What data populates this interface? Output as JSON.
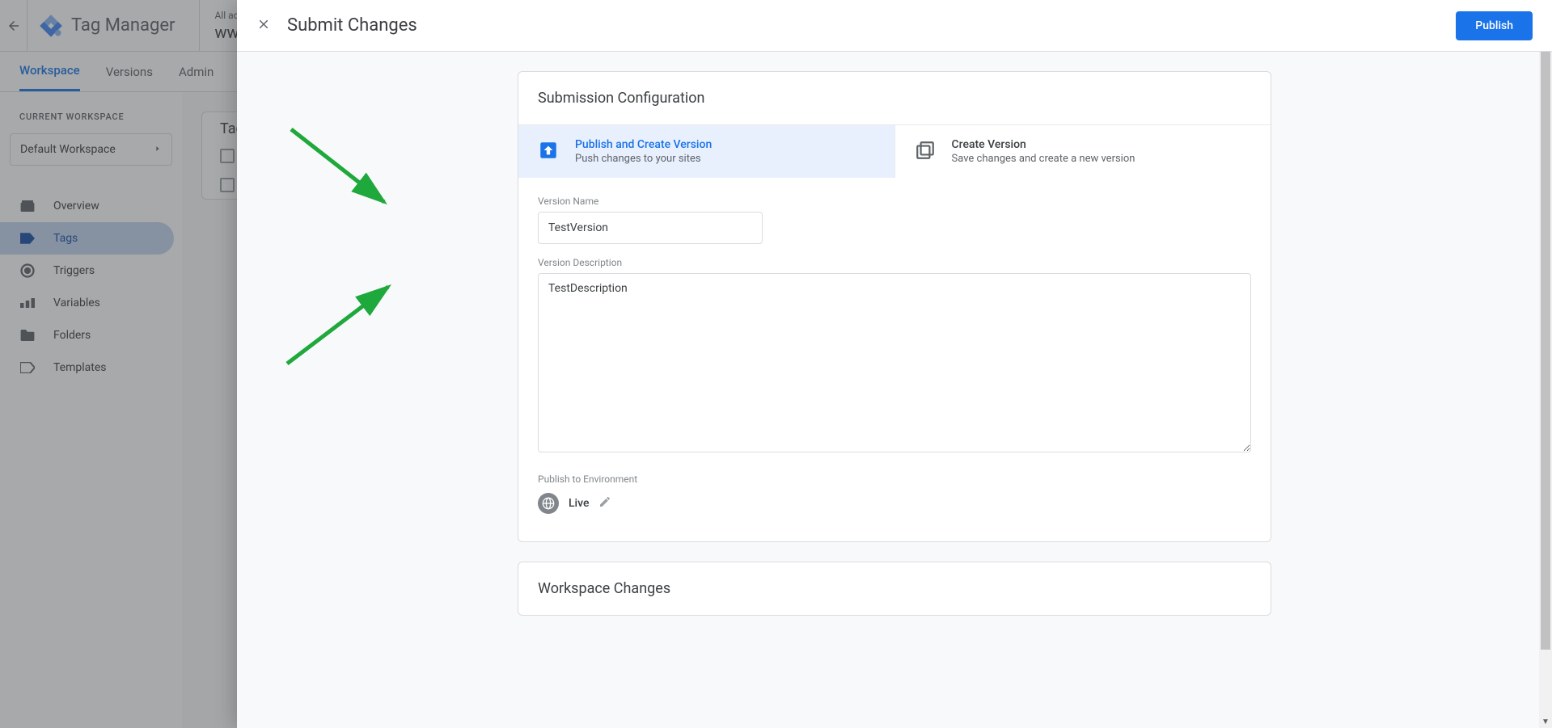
{
  "app": {
    "title": "Tag Manager",
    "account_label": "All acc",
    "domain": "ww"
  },
  "subnav": {
    "workspace": "Workspace",
    "versions": "Versions",
    "admin": "Admin"
  },
  "sidebar": {
    "current_label": "CURRENT WORKSPACE",
    "workspace_name": "Default Workspace",
    "items": {
      "overview": "Overview",
      "tags": "Tags",
      "triggers": "Triggers",
      "variables": "Variables",
      "folders": "Folders",
      "templates": "Templates"
    }
  },
  "content": {
    "heading": "Tag"
  },
  "panel": {
    "title": "Submit Changes",
    "publish_btn": "Publish",
    "card1_title": "Submission Configuration",
    "option1": {
      "title": "Publish and Create Version",
      "sub": "Push changes to your sites"
    },
    "option2": {
      "title": "Create Version",
      "sub": "Save changes and create a new version"
    },
    "version_name_label": "Version Name",
    "version_name_value": "TestVersion",
    "version_desc_label": "Version Description",
    "version_desc_value": "TestDescription",
    "env_label": "Publish to Environment",
    "env_name": "Live",
    "card2_title": "Workspace Changes"
  }
}
